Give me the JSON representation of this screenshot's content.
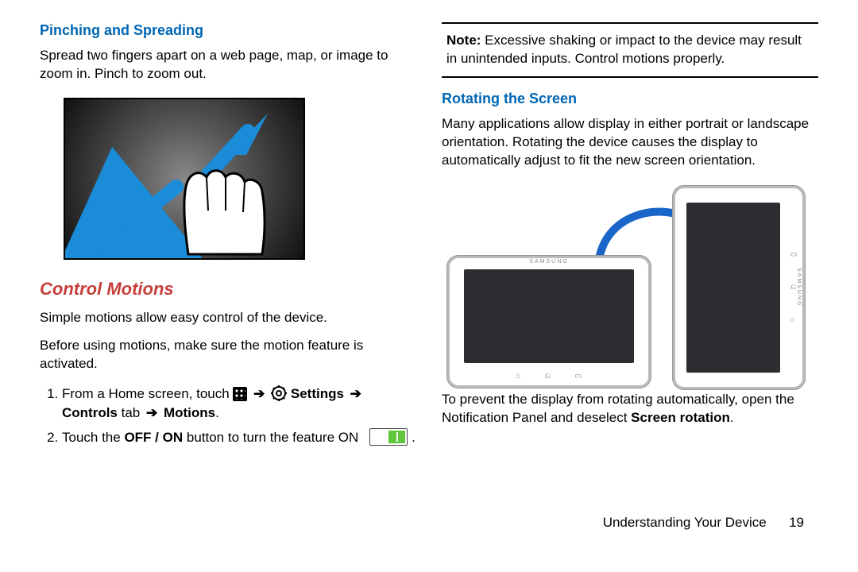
{
  "left": {
    "h1": "Pinching and Spreading",
    "p1": "Spread two fingers apart on a web page, map, or image to zoom in. Pinch to zoom out.",
    "h2": "Control Motions",
    "p2": "Simple motions allow easy control of the device.",
    "p3": "Before using motions, make sure the motion feature is activated.",
    "step1_pre": "From a Home screen, touch ",
    "settings_word": "Settings",
    "step1_post": "Controls",
    "step1_tab": " tab ",
    "motions_word": "Motions",
    "step2_pre": "Touch the ",
    "offon": "OFF / ON",
    "step2_mid": " button to turn the feature ",
    "on_word": "ON"
  },
  "right": {
    "note_label": "Note:",
    "note_body": " Excessive shaking or impact to the device may result in unintended inputs. Control motions properly.",
    "h1": "Rotating the Screen",
    "p1": "Many applications allow display in either portrait or landscape orientation. Rotating the device causes the display to automatically adjust to fit the new screen orientation.",
    "p2_pre": "To prevent the display from rotating automatically, open the Notification Panel and deselect ",
    "screen_rotation": "Screen rotation",
    "p2_post": "."
  },
  "brand": "SAMSUNG",
  "footer": {
    "chapter": "Understanding Your Device",
    "page": "19"
  }
}
